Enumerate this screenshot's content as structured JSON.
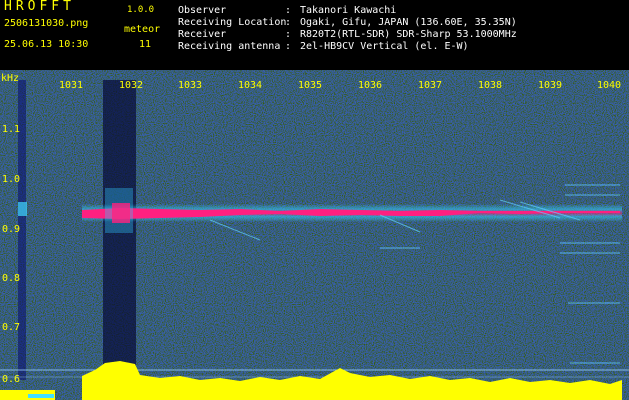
{
  "app": {
    "name": "HROFFT",
    "version": "1.0.0"
  },
  "file_name": "2506131030.png",
  "datetime": "25.06.13 10:30",
  "meteor": {
    "label": "meteor",
    "count": "11"
  },
  "info": [
    {
      "key": "Observer",
      "value": "Takanori Kawachi"
    },
    {
      "key": "Receiving Location",
      "value": "Ogaki, Gifu, JAPAN (136.60E, 35.35N)"
    },
    {
      "key": "Receiver",
      "value": "R820T2(RTL-SDR) SDR-Sharp 53.1000MHz"
    },
    {
      "key": "Receiving antenna",
      "value": "2el-HB9CV Vertical (el. E-W)"
    }
  ],
  "axis": {
    "x_unit": "kHz",
    "x_ticks": [
      "1031",
      "1032",
      "1033",
      "1034",
      "1035",
      "1036",
      "1037",
      "1038",
      "1039",
      "1040"
    ],
    "y_ticks": [
      "1.1",
      "1.0",
      "0.9",
      "0.8",
      "0.7",
      "0.6"
    ]
  },
  "colors": {
    "background_noise": "#0a0f6a",
    "signal": "#ff2080",
    "level_bars": "#ffff00",
    "text": "#ffff00"
  }
}
